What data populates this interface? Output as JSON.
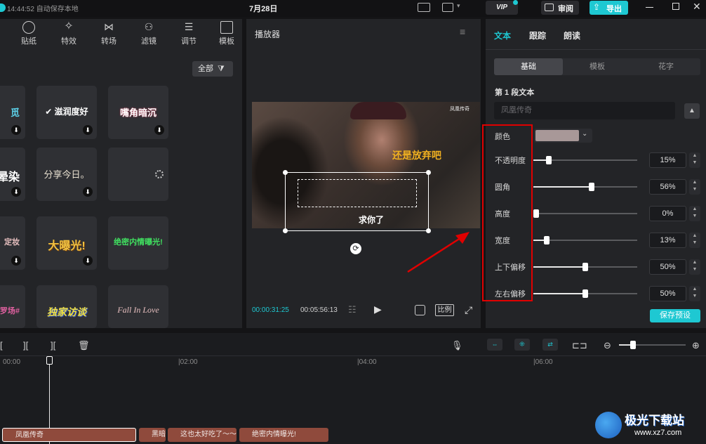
{
  "topbar": {
    "autosave": "14:44:52 自动保存本地",
    "date": "7月28日",
    "vip": "VIP",
    "review": "审阅",
    "export": "导出"
  },
  "categories": [
    "贴纸",
    "特效",
    "转场",
    "滤镜",
    "调节",
    "模板"
  ],
  "filter_label": "全部",
  "templates": [
    {
      "text": "觅",
      "color": "#e8e8e8"
    },
    {
      "text": "✔ 滋润度好",
      "color": "#ffffff"
    },
    {
      "text": "嘴角暗沉",
      "color": "#ffffff"
    },
    {
      "text": "晕染",
      "color": "#ffffff"
    },
    {
      "text": "分享今日。",
      "color": "#e8e0d0"
    },
    {
      "text": "",
      "color": "#ffffff"
    },
    {
      "text": "定妆",
      "color": "#e8c0c0"
    },
    {
      "text": "大曝光!",
      "color": "#f0c040"
    },
    {
      "text": "绝密内情曝光!",
      "color": "#40e060"
    },
    {
      "text": "罗场#",
      "color": "#e060a0"
    },
    {
      "text": "独家访谈",
      "color": "#f0e040"
    },
    {
      "text": "Fall In Love",
      "color": "#e8c0c0"
    }
  ],
  "player": {
    "title": "播放器",
    "current_time": "00:00:31:25",
    "total_time": "00:05:56:13",
    "ratio_label": "比例",
    "caption_top": "还是放弃吧",
    "caption_bottom": "求你了",
    "watermark": "凤凰传奇"
  },
  "right_panel": {
    "tabs": [
      "文本",
      "跟踪",
      "朗读"
    ],
    "subtabs": [
      "基础",
      "模板",
      "花字"
    ],
    "section_title": "第 1 段文本",
    "text_value": "凤凰传奇",
    "color_label": "颜色",
    "properties": [
      {
        "label": "不透明度",
        "value": "15%",
        "level": 0.15
      },
      {
        "label": "圆角",
        "value": "56%",
        "level": 0.56
      },
      {
        "label": "高度",
        "value": "0%",
        "level": 0.0
      },
      {
        "label": "宽度",
        "value": "13%",
        "level": 0.13
      },
      {
        "label": "上下偏移",
        "value": "50%",
        "level": 0.5
      },
      {
        "label": "左右偏移",
        "value": "50%",
        "level": 0.5
      }
    ],
    "save_preset": "保存预设"
  },
  "timeline": {
    "ticks": [
      "00:00",
      "|02:00",
      "|04:00",
      "|06:00"
    ],
    "clips": [
      "凤凰传奇",
      "黑暗",
      "这也太好吃了～～",
      "绝密内情曝光!"
    ]
  },
  "watermark_site": {
    "name": "极光下载站",
    "url": "www.xz7.com"
  },
  "colors": {
    "accent": "#1ec8d2",
    "highlight_red": "#e00000",
    "clip": "#8f4a3c"
  }
}
